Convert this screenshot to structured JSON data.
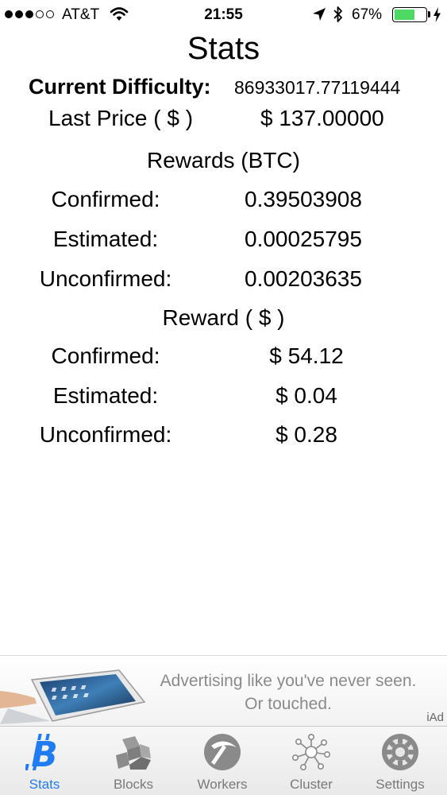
{
  "status_bar": {
    "carrier": "AT&T",
    "time": "21:55",
    "battery_percent_text": "67%",
    "battery_level": 0.67,
    "signal_bars": 3,
    "signal_total": 5,
    "icons": [
      "wifi-icon",
      "location-arrow-icon",
      "bluetooth-icon",
      "battery-icon",
      "charging-bolt-icon"
    ]
  },
  "page": {
    "title": "Stats"
  },
  "summary": {
    "difficulty_label": "Current Difficulty:",
    "difficulty_value": "86933017.77119444",
    "price_label": "Last Price ( $ )",
    "price_value": "$ 137.00000"
  },
  "rewards_btc": {
    "heading": "Rewards (BTC)",
    "rows": [
      {
        "label": "Confirmed:",
        "value": "0.39503908"
      },
      {
        "label": "Estimated:",
        "value": "0.00025795"
      },
      {
        "label": "Unconfirmed:",
        "value": "0.00203635"
      }
    ]
  },
  "rewards_usd": {
    "heading": "Reward ( $ )",
    "rows": [
      {
        "label": "Confirmed:",
        "value": "$ 54.12"
      },
      {
        "label": "Estimated:",
        "value": "$ 0.04"
      },
      {
        "label": "Unconfirmed:",
        "value": "$ 0.28"
      }
    ]
  },
  "ad": {
    "line1": "Advertising like you've never seen.",
    "line2": "Or touched.",
    "label": "iAd"
  },
  "tabs": [
    {
      "label": "Stats",
      "icon": "bitcoin-icon",
      "active": true
    },
    {
      "label": "Blocks",
      "icon": "blocks-icon",
      "active": false
    },
    {
      "label": "Workers",
      "icon": "pickaxe-icon",
      "active": false
    },
    {
      "label": "Cluster",
      "icon": "cluster-icon",
      "active": false
    },
    {
      "label": "Settings",
      "icon": "gear-icon",
      "active": false
    }
  ],
  "colors": {
    "accent": "#1f7cf2",
    "battery_fill": "#4cd964",
    "tab_inactive": "#7a7a7a",
    "ad_text": "#8a8a8a"
  }
}
